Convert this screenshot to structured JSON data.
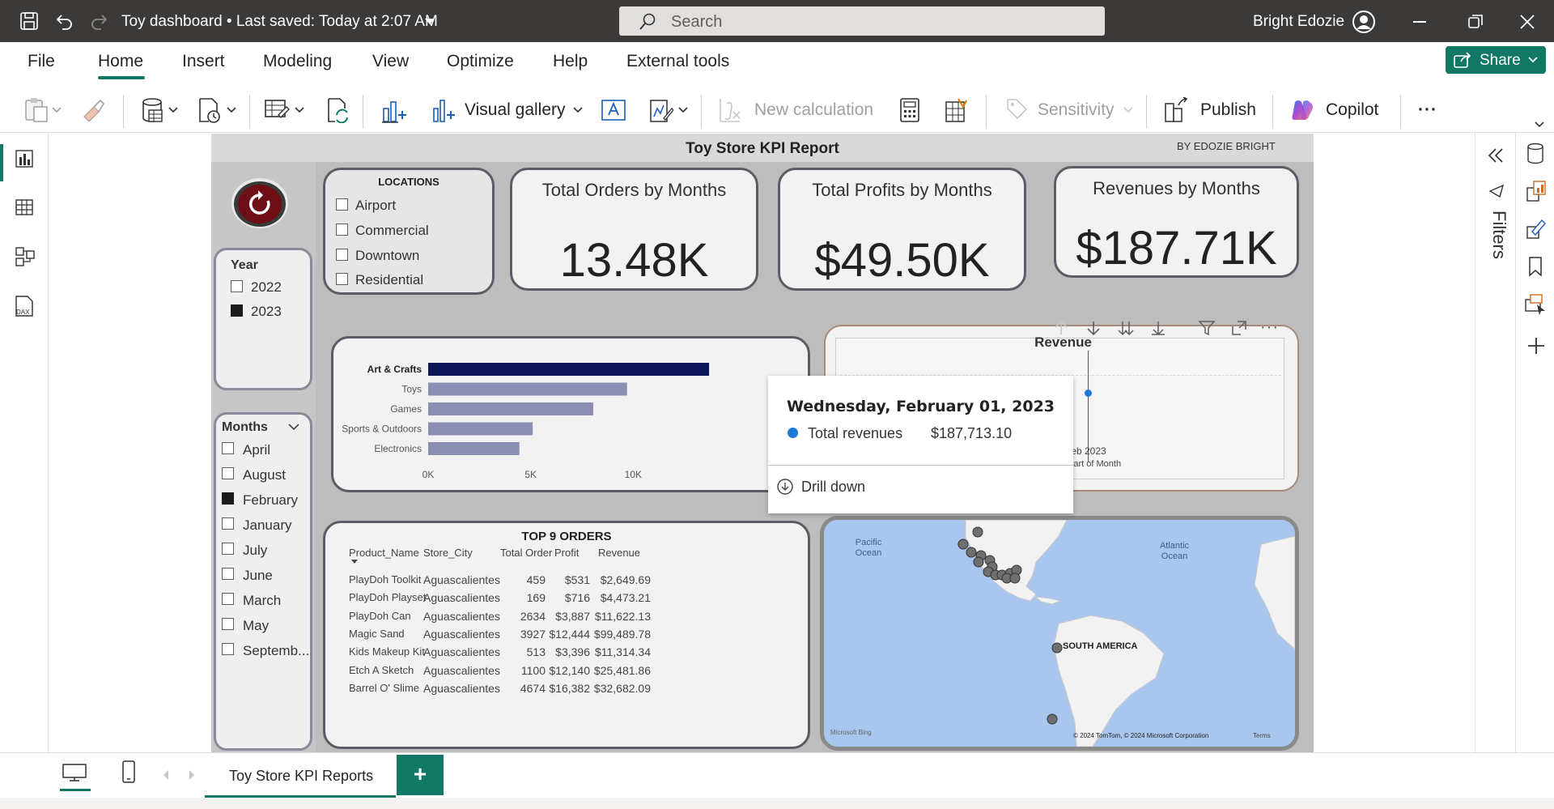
{
  "titlebar": {
    "doc_title": "Toy dashboard • Last saved: Today at 2:07 AM",
    "search_placeholder": "Search",
    "user_name": "Bright Edozie"
  },
  "menu": {
    "items": [
      "File",
      "Home",
      "Insert",
      "Modeling",
      "View",
      "Optimize",
      "Help",
      "External tools"
    ],
    "active": "Home",
    "share_label": "Share"
  },
  "ribbon": {
    "visual_gallery": "Visual gallery",
    "new_calculation": "New calculation",
    "sensitivity": "Sensitivity",
    "publish": "Publish",
    "copilot": "Copilot",
    "more": "···"
  },
  "report": {
    "title": "Toy Store KPI Report",
    "byline": "BY EDOZIE BRIGHT",
    "locations": {
      "header": "LOCATIONS",
      "items": [
        {
          "label": "Airport",
          "checked": false
        },
        {
          "label": "Commercial",
          "checked": false
        },
        {
          "label": "Downtown",
          "checked": false
        },
        {
          "label": "Residential",
          "checked": false
        }
      ]
    },
    "year": {
      "header": "Year",
      "items": [
        {
          "label": "2022",
          "checked": false
        },
        {
          "label": "2023",
          "checked": true
        }
      ]
    },
    "months": {
      "header": "Months",
      "items": [
        {
          "label": "April",
          "checked": false
        },
        {
          "label": "August",
          "checked": false
        },
        {
          "label": "February",
          "checked": true
        },
        {
          "label": "January",
          "checked": false
        },
        {
          "label": "July",
          "checked": false
        },
        {
          "label": "June",
          "checked": false
        },
        {
          "label": "March",
          "checked": false
        },
        {
          "label": "May",
          "checked": false
        },
        {
          "label": "Septemb...",
          "checked": false
        }
      ]
    },
    "kpis": [
      {
        "title": "Total Orders by Months",
        "value": "13.48K"
      },
      {
        "title": "Total Profits by Months",
        "value": "$49.50K"
      },
      {
        "title": "Revenues by Months",
        "value": "$187.71K"
      }
    ],
    "bar_chart": {
      "chart_data": {
        "type": "bar",
        "orientation": "horizontal",
        "categories": [
          "Art & Crafts",
          "Toys",
          "Games",
          "Sports & Outdoors",
          "Electronics"
        ],
        "values": [
          13700,
          9700,
          8050,
          5100,
          4450
        ],
        "highlighted": "Art & Crafts",
        "x_ticks": [
          "0K",
          "5K",
          "10K"
        ],
        "xlim": [
          0,
          15000
        ],
        "colors": {
          "highlight": "#0b1557",
          "normal": "#8c8fb3"
        }
      }
    },
    "revenue_chart": {
      "title": "Revenue",
      "x_tick": "Feb 2023",
      "x_label": "Start of Month"
    },
    "tooltip": {
      "date": "Wednesday, February 01, 2023",
      "series": "Total revenues",
      "value": "$187,713.10",
      "action": "Drill down"
    },
    "table": {
      "title": "TOP 9 ORDERS",
      "columns": [
        "Product_Name",
        "Store_City",
        "Total Order",
        "Profit",
        "Revenue"
      ],
      "rows": [
        [
          "PlayDoh Toolkit",
          "Aguascalientes",
          "459",
          "$531",
          "$2,649.69"
        ],
        [
          "PlayDoh Playset",
          "Aguascalientes",
          "169",
          "$716",
          "$4,473.21"
        ],
        [
          "PlayDoh Can",
          "Aguascalientes",
          "2634",
          "$3,887",
          "$11,622.13"
        ],
        [
          "Magic Sand",
          "Aguascalientes",
          "3927",
          "$12,444",
          "$99,489.78"
        ],
        [
          "Kids Makeup Kit",
          "Aguascalientes",
          "513",
          "$3,396",
          "$11,314.34"
        ],
        [
          "Etch A Sketch",
          "Aguascalientes",
          "1100",
          "$12,140",
          "$25,481.86"
        ],
        [
          "Barrel O' Slime",
          "Aguascalientes",
          "4674",
          "$16,382",
          "$32,682.09"
        ]
      ]
    },
    "map": {
      "labels": [
        "Pacific Ocean",
        "Atlantic Ocean",
        "SOUTH AMERICA"
      ],
      "provider": "Microsoft Bing",
      "copyright": "© 2024 TomTom, © 2024 Microsoft Corporation",
      "terms": "Terms"
    }
  },
  "filters_label": "Filters",
  "pages": {
    "tabs": [
      "Toy Store KPI Reports"
    ],
    "add_label": "+"
  },
  "colors": {
    "titlebar": "#3b3a39",
    "accent": "#117865",
    "report_bg": "#bdbdbd",
    "card_border": "#5c5c66",
    "bar_highlight": "#0b1557",
    "bar_normal": "#8c8fb3",
    "map_water": "#a9c6ee",
    "map_land": "#f2f2f2"
  }
}
